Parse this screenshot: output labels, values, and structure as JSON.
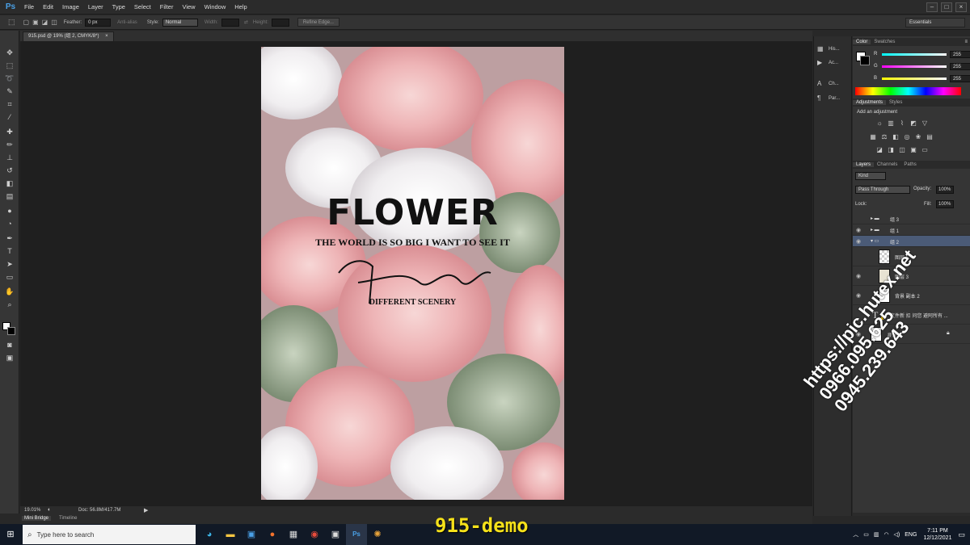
{
  "app": {
    "logo": "Ps",
    "menu": [
      "File",
      "Edit",
      "Image",
      "Layer",
      "Type",
      "Select",
      "Filter",
      "View",
      "Window",
      "Help"
    ]
  },
  "options": {
    "feather_label": "Feather:",
    "feather_value": "0 px",
    "antialias": "Anti-alias",
    "style_label": "Style:",
    "style_value": "Normal",
    "width_label": "Width:",
    "height_label": "Height:",
    "refine_edge": "Refine Edge...",
    "workspace": "Essentials"
  },
  "document": {
    "tab_title": "915.psd @ 19% (组 2, CMYK/8*)",
    "zoom": "19.01%",
    "doc_info": "Doc: 56.8M/417.7M",
    "poster": {
      "title": "FLOWER",
      "subtitle": "THE WORLD IS SO BIG I WANT TO SEE IT",
      "tagline": "DIFFERENT SCENERY"
    }
  },
  "bottom_tabs": [
    "Mini Bridge",
    "Timeline"
  ],
  "strip": [
    {
      "label": "His...",
      "icon": "history-icon"
    },
    {
      "label": "Ac...",
      "icon": "actions-icon"
    },
    {
      "label": "Ch...",
      "icon": "character-icon"
    },
    {
      "label": "Par...",
      "icon": "paragraph-icon"
    }
  ],
  "color_panel": {
    "tabs": [
      "Color",
      "Swatches"
    ],
    "r_label": "R",
    "g_label": "G",
    "b_label": "B",
    "r": "255",
    "g": "255",
    "b": "255"
  },
  "adjustments": {
    "tabs": [
      "Adjustments",
      "Styles"
    ],
    "heading": "Add an adjustment"
  },
  "layers": {
    "tabs": [
      "Layers",
      "Channels",
      "Paths"
    ],
    "kind": "Kind",
    "blend": "Pass Through",
    "opacity_label": "Opacity:",
    "opacity": "100%",
    "lock_label": "Lock:",
    "fill_label": "Fill:",
    "fill": "100%",
    "items": [
      {
        "name": "组 3",
        "type": "group"
      },
      {
        "name": "组 1",
        "type": "group"
      },
      {
        "name": "组 2",
        "type": "group-open"
      },
      {
        "name": "图层 5",
        "type": "layer"
      },
      {
        "name": "图层 3",
        "type": "layer"
      },
      {
        "name": "背景 副本 2",
        "type": "layer"
      },
      {
        "name": "文件新 扣 问您 避阿所有 ...",
        "type": "text"
      },
      {
        "name": "背景",
        "type": "layer"
      }
    ]
  },
  "taskbar": {
    "search_placeholder": "Type here to search",
    "lang": "ENG",
    "time": "7:11 PM",
    "date": "12/12/2021"
  },
  "overlay": {
    "demo_label": "915-demo",
    "watermark_lines": [
      "https://pic.hutex.net",
      "0966.095.625",
      "0945.239.643"
    ]
  }
}
